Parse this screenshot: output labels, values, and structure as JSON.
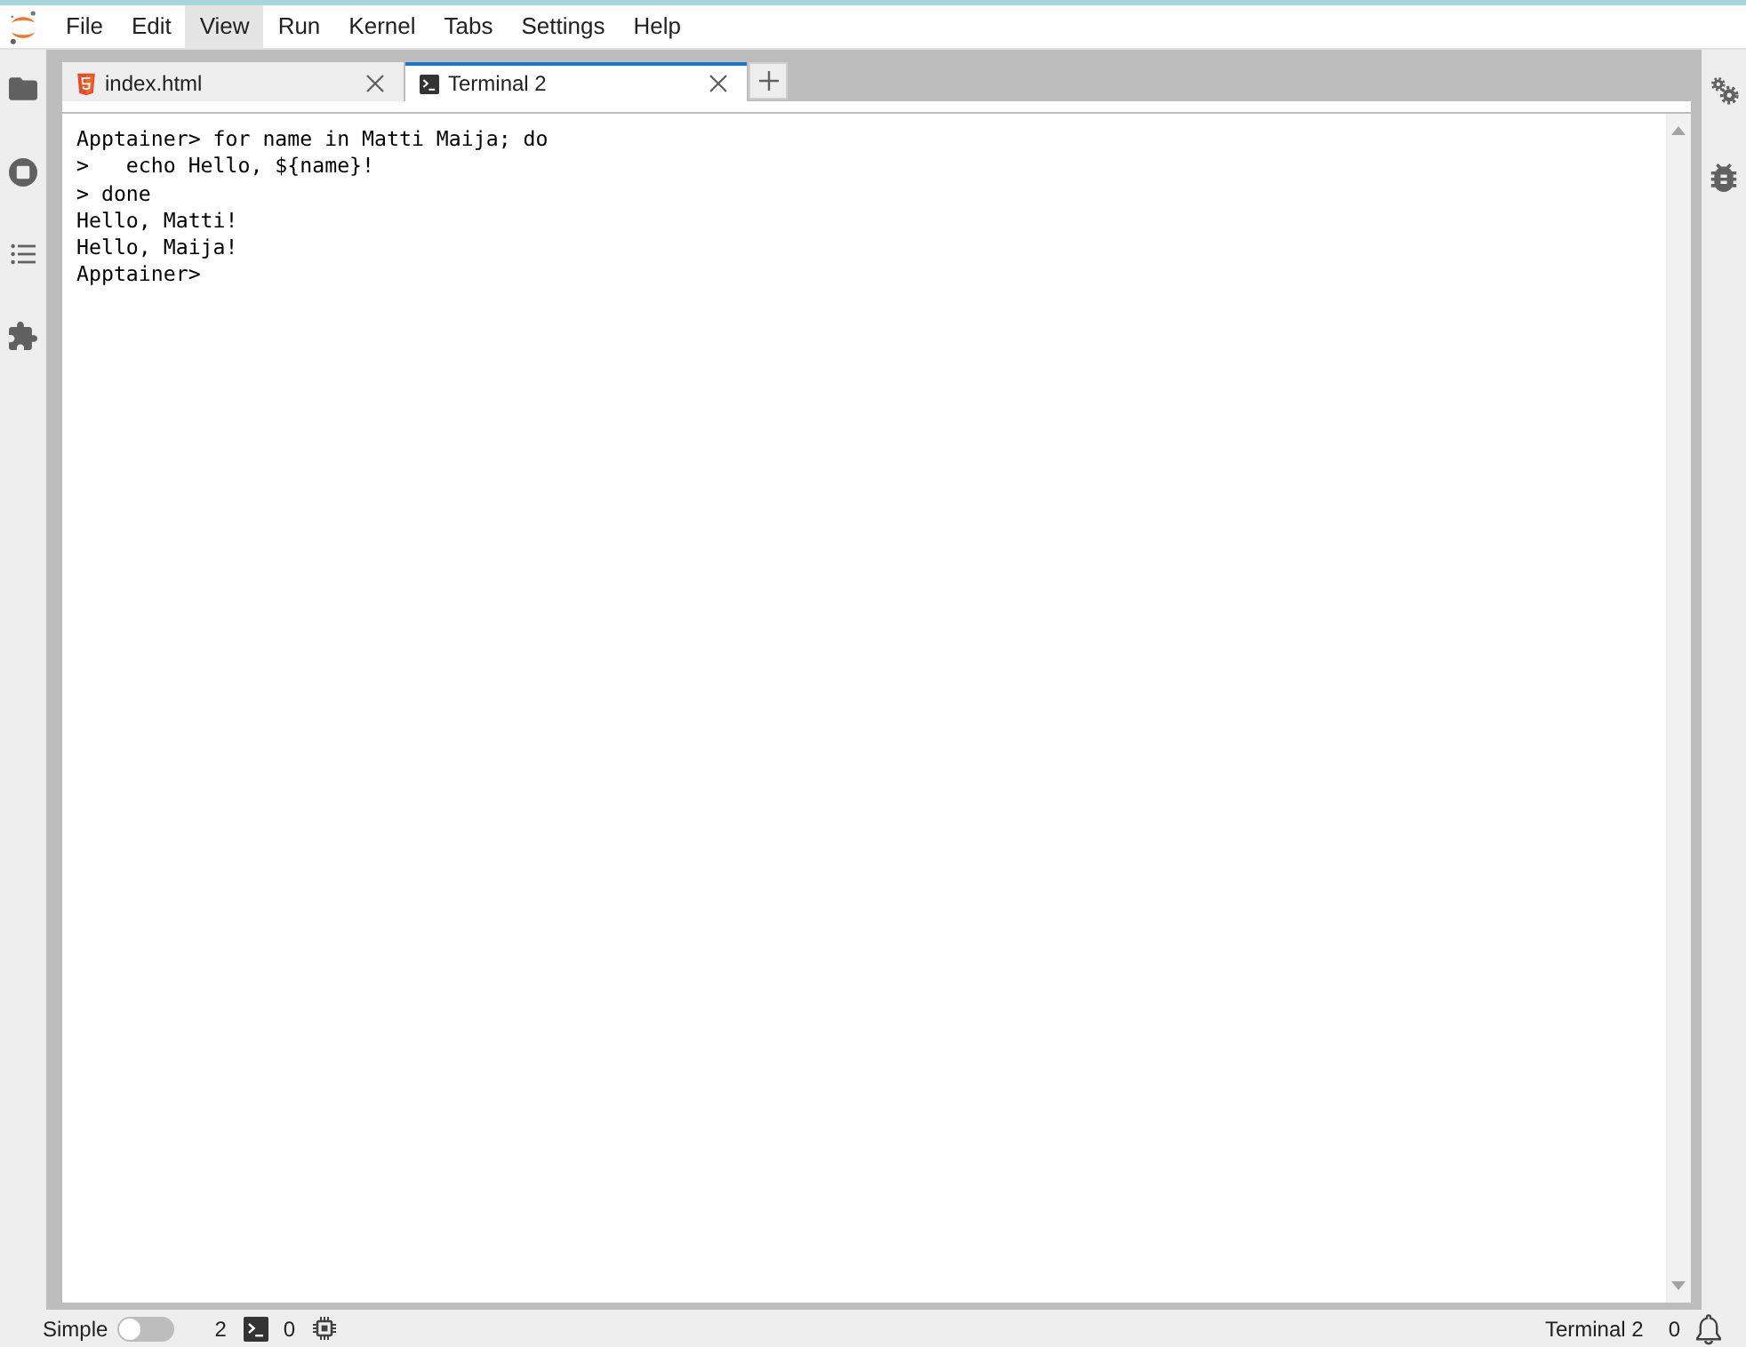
{
  "menu_bar": {
    "items": [
      {
        "label": "File",
        "selected": false
      },
      {
        "label": "Edit",
        "selected": false
      },
      {
        "label": "View",
        "selected": true
      },
      {
        "label": "Run",
        "selected": false
      },
      {
        "label": "Kernel",
        "selected": false
      },
      {
        "label": "Tabs",
        "selected": false
      },
      {
        "label": "Settings",
        "selected": false
      },
      {
        "label": "Help",
        "selected": false
      }
    ]
  },
  "tabs": [
    {
      "label": "index.html",
      "kind": "html",
      "selected": false
    },
    {
      "label": "Terminal 2",
      "kind": "terminal",
      "selected": true
    }
  ],
  "terminal": {
    "lines": [
      "Apptainer> for name in Matti Maija; do",
      ">   echo Hello, ${name}!",
      "> done",
      "Hello, Matti!",
      "Hello, Maija!",
      "Apptainer>"
    ]
  },
  "status_bar": {
    "mode_label": "Simple",
    "mode_toggle": {
      "on": false
    },
    "terminals_count": "2",
    "kernels_count": "0",
    "current_document": "Terminal 2",
    "notifications_count": "0"
  }
}
